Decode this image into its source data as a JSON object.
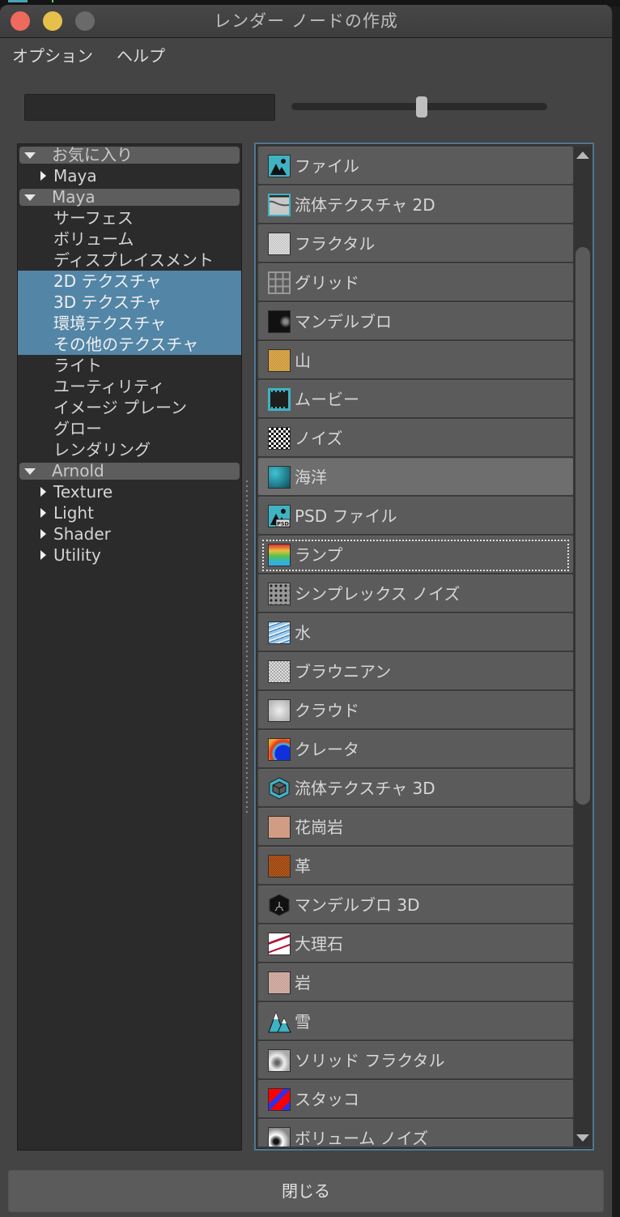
{
  "window": {
    "title": "レンダー ノードの作成"
  },
  "menubar": {
    "items": [
      "オプション",
      "ヘルプ"
    ]
  },
  "toolbar": {
    "search_value": "",
    "slider_fraction": 0.51
  },
  "tree": {
    "rows": [
      {
        "label": "お気に入り",
        "kind": "group",
        "expanded": true
      },
      {
        "label": "Maya",
        "kind": "sub",
        "expanded": false
      },
      {
        "label": "Maya",
        "kind": "group",
        "expanded": true
      },
      {
        "label": "サーフェス",
        "kind": "leaf"
      },
      {
        "label": "ボリューム",
        "kind": "leaf"
      },
      {
        "label": "ディスプレイスメント",
        "kind": "leaf"
      },
      {
        "label": "2D テクスチャ",
        "kind": "leaf",
        "selected": true
      },
      {
        "label": "3D テクスチャ",
        "kind": "leaf",
        "selected": true
      },
      {
        "label": "環境テクスチャ",
        "kind": "leaf",
        "selected": true
      },
      {
        "label": "その他のテクスチャ",
        "kind": "leaf",
        "selected": true
      },
      {
        "label": "ライト",
        "kind": "leaf"
      },
      {
        "label": "ユーティリティ",
        "kind": "leaf"
      },
      {
        "label": "イメージ プレーン",
        "kind": "leaf"
      },
      {
        "label": "グロー",
        "kind": "leaf"
      },
      {
        "label": "レンダリング",
        "kind": "leaf"
      },
      {
        "label": "Arnold",
        "kind": "group",
        "expanded": true
      },
      {
        "label": "Texture",
        "kind": "sub",
        "expanded": false
      },
      {
        "label": "Light",
        "kind": "sub",
        "expanded": false
      },
      {
        "label": "Shader",
        "kind": "sub",
        "expanded": false
      },
      {
        "label": "Utility",
        "kind": "sub",
        "expanded": false
      }
    ]
  },
  "nodes": {
    "items": [
      {
        "label": "ファイル",
        "icon": "file-icon",
        "tex": "file"
      },
      {
        "label": "流体テクスチャ 2D",
        "icon": "fluid-texture-2d-icon",
        "tex": "fluid2d"
      },
      {
        "label": "フラクタル",
        "icon": "fractal-icon",
        "tex": "fractal"
      },
      {
        "label": "グリッド",
        "icon": "grid-icon",
        "tex": "grid"
      },
      {
        "label": "マンデルブロ",
        "icon": "mandelbrot-icon",
        "tex": "mandelbrot"
      },
      {
        "label": "山",
        "icon": "mountain-icon",
        "tex": "mountain"
      },
      {
        "label": "ムービー",
        "icon": "movie-icon",
        "tex": "movie"
      },
      {
        "label": "ノイズ",
        "icon": "noise-icon",
        "tex": "noise"
      },
      {
        "label": "海洋",
        "icon": "ocean-icon",
        "tex": "ocean",
        "hover": true
      },
      {
        "label": "PSD ファイル",
        "icon": "psd-file-icon",
        "tex": "psd"
      },
      {
        "label": "ランプ",
        "icon": "ramp-icon",
        "tex": "ramp",
        "focused": true
      },
      {
        "label": "シンプレックス ノイズ",
        "icon": "simplex-noise-icon",
        "tex": "simplex"
      },
      {
        "label": "水",
        "icon": "water-icon",
        "tex": "water"
      },
      {
        "label": "ブラウニアン",
        "icon": "brownian-icon",
        "tex": "brownian"
      },
      {
        "label": "クラウド",
        "icon": "cloud-icon",
        "tex": "cloud"
      },
      {
        "label": "クレータ",
        "icon": "crater-icon",
        "tex": "crater"
      },
      {
        "label": "流体テクスチャ 3D",
        "icon": "fluid-texture-3d-icon",
        "tex": "fluid3d"
      },
      {
        "label": "花崗岩",
        "icon": "granite-icon",
        "tex": "granite"
      },
      {
        "label": "革",
        "icon": "leather-icon",
        "tex": "leather"
      },
      {
        "label": "マンデルブロ 3D",
        "icon": "mandelbrot-3d-icon",
        "tex": "mandel3d"
      },
      {
        "label": "大理石",
        "icon": "marble-icon",
        "tex": "marble"
      },
      {
        "label": "岩",
        "icon": "rock-icon",
        "tex": "rock"
      },
      {
        "label": "雪",
        "icon": "snow-icon",
        "tex": "snow"
      },
      {
        "label": "ソリッド フラクタル",
        "icon": "solid-fractal-icon",
        "tex": "solid"
      },
      {
        "label": "スタッコ",
        "icon": "stucco-icon",
        "tex": "stucco"
      },
      {
        "label": "ボリューム ノイズ",
        "icon": "volume-noise-icon",
        "tex": "volume"
      }
    ],
    "scroll": {
      "visible_fraction": 0.58,
      "position_fraction": 0.0
    }
  },
  "footer": {
    "close_label": "閉じる"
  },
  "colors": {
    "selection": "#5285a6",
    "focus_border": "#4f7896",
    "window_bg": "#444444"
  }
}
